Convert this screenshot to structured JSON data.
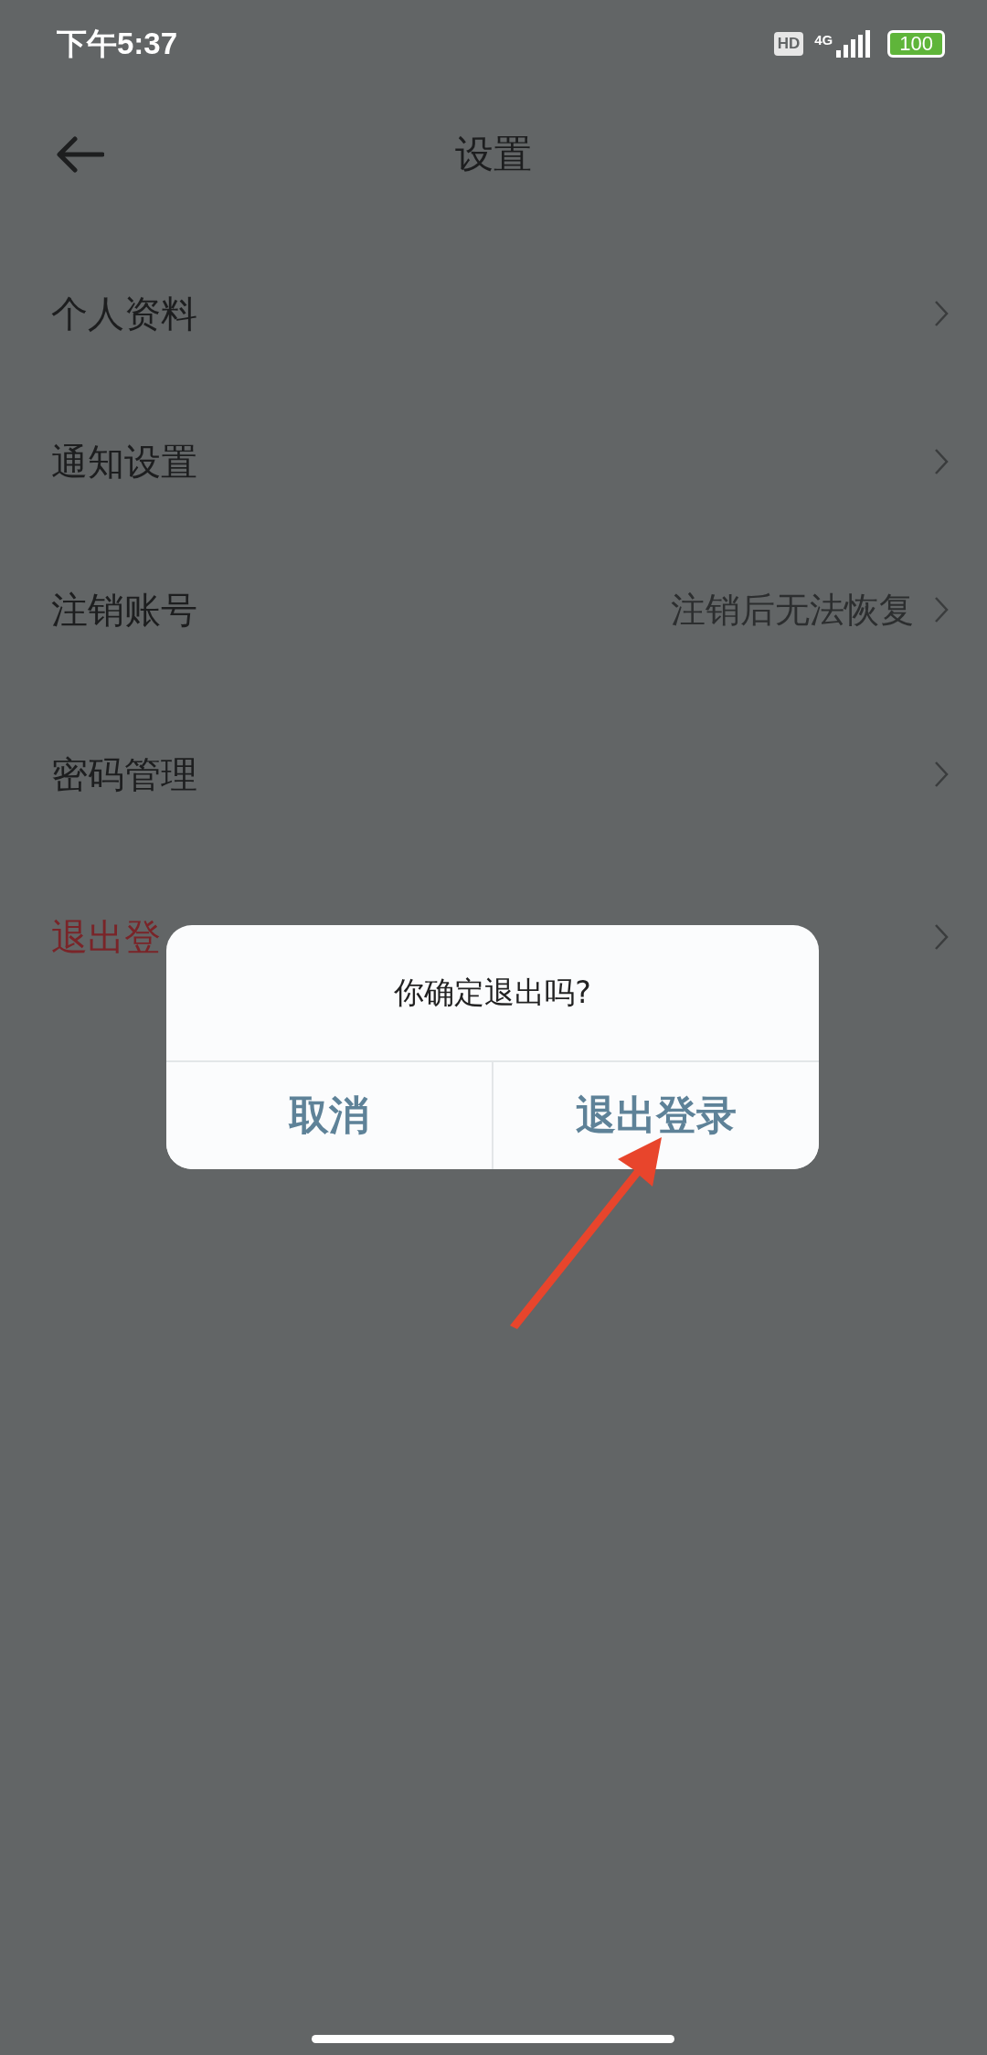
{
  "status_bar": {
    "time": "下午5:37",
    "hd": "HD",
    "network": "4G",
    "battery": "100"
  },
  "header": {
    "title": "设置"
  },
  "items": [
    {
      "label": "个人资料",
      "kind": "normal"
    },
    {
      "label": "通知设置",
      "kind": "normal"
    },
    {
      "label": "注销账号",
      "kind": "normal",
      "detail": "注销后无法恢复"
    },
    {
      "label": "密码管理",
      "kind": "normal"
    },
    {
      "label": "退出登",
      "kind": "danger"
    }
  ],
  "dialog": {
    "message": "你确定退出吗?",
    "buttons": [
      "取消",
      "退出登录"
    ]
  }
}
